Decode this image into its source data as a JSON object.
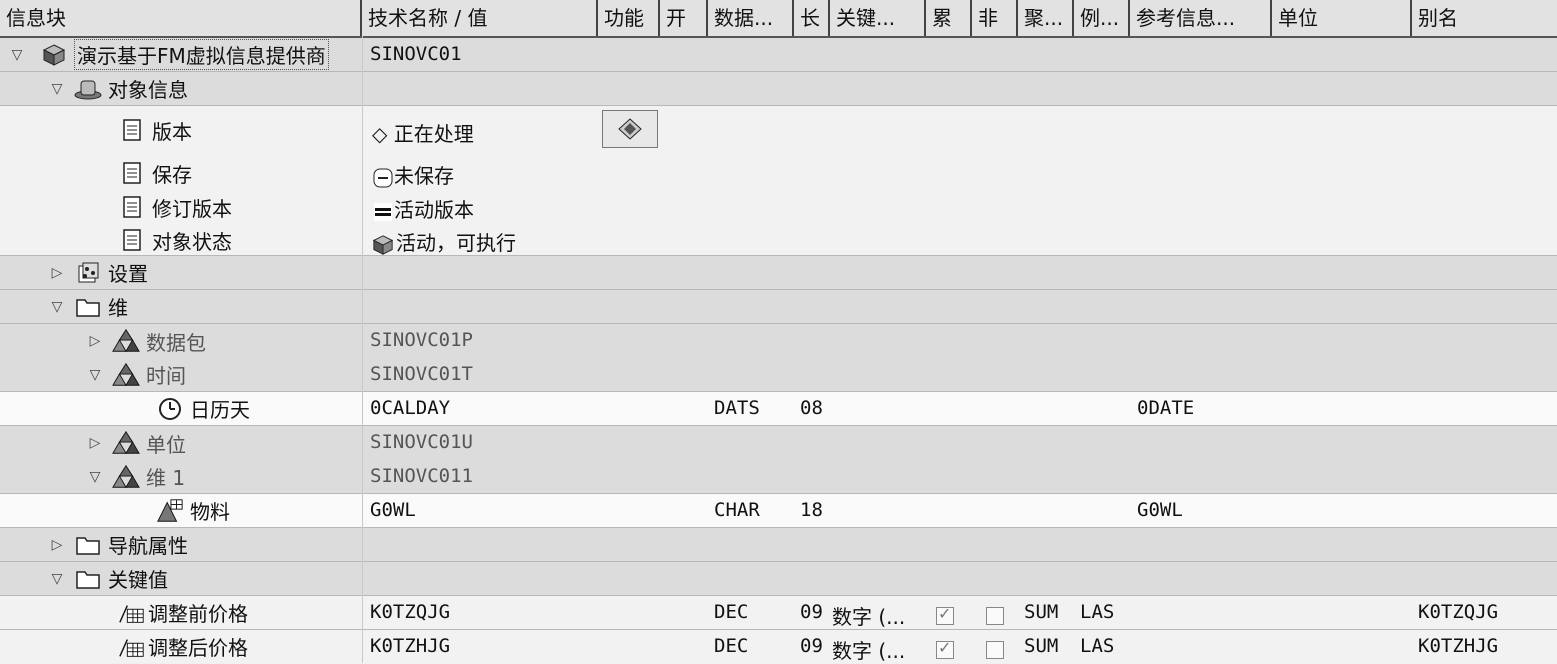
{
  "columns": [
    {
      "label": "信息块"
    },
    {
      "label": "技术名称 / 值"
    },
    {
      "label": "功能"
    },
    {
      "label": "开"
    },
    {
      "label": "数据..."
    },
    {
      "label": "长"
    },
    {
      "label": "关键..."
    },
    {
      "label": "累"
    },
    {
      "label": "非"
    },
    {
      "label": "聚..."
    },
    {
      "label": "例..."
    },
    {
      "label": "参考信息..."
    },
    {
      "label": "单位"
    },
    {
      "label": "别名"
    }
  ],
  "rows": {
    "r0": {
      "name": "演示基于FM虚拟信息提供商",
      "tech": "SINOVC01"
    },
    "r1": {
      "name": "对象信息"
    },
    "r2": {
      "name": "版本",
      "value": "正在处理"
    },
    "r3": {
      "name": "保存",
      "value": "未保存"
    },
    "r4": {
      "name": "修订版本",
      "value": "活动版本"
    },
    "r5": {
      "name": "对象状态",
      "value": "活动，可执行"
    },
    "r6": {
      "name": "设置"
    },
    "r7": {
      "name": "维"
    },
    "r8": {
      "name": "数据包",
      "tech": "SINOVC01P"
    },
    "r9": {
      "name": "时间",
      "tech": "SINOVC01T"
    },
    "r10": {
      "name": "日历天",
      "tech": "0CALDAY",
      "dtype": "DATS",
      "len": "08",
      "ref": "0DATE"
    },
    "r11": {
      "name": "单位",
      "tech": "SINOVC01U"
    },
    "r12": {
      "name": "维 1",
      "tech": "SINOVC011"
    },
    "r13": {
      "name": "物料",
      "tech": "G0WL",
      "dtype": "CHAR",
      "len": "18",
      "ref": "G0WL"
    },
    "r14": {
      "name": "导航属性"
    },
    "r15": {
      "name": "关键值"
    },
    "r16": {
      "name": "调整前价格",
      "tech": "K0TZQJG",
      "dtype": "DEC",
      "len": "09",
      "keytype": "数字 (...",
      "cumulative": true,
      "noncum": false,
      "agg": "SUM",
      "exc": "LAS",
      "alias": "K0TZQJG"
    },
    "r17": {
      "name": "调整后价格",
      "tech": "K0TZHJG",
      "dtype": "DEC",
      "len": "09",
      "keytype": "数字 (...",
      "cumulative": true,
      "noncum": false,
      "agg": "SUM",
      "exc": "LAS",
      "alias": "K0TZHJG"
    }
  },
  "icons": {
    "cube": "infocube-icon",
    "hat": "object-info-icon",
    "doc": "document-icon",
    "diamond": "diamond-icon",
    "minus": "minus-icon",
    "equals": "equals-icon",
    "settings": "settings-icon",
    "folder": "folder-icon",
    "dimension": "dimension-icon",
    "clock": "clock-icon",
    "characteristic": "characteristic-icon",
    "keyfigure": "keyfigure-icon"
  }
}
